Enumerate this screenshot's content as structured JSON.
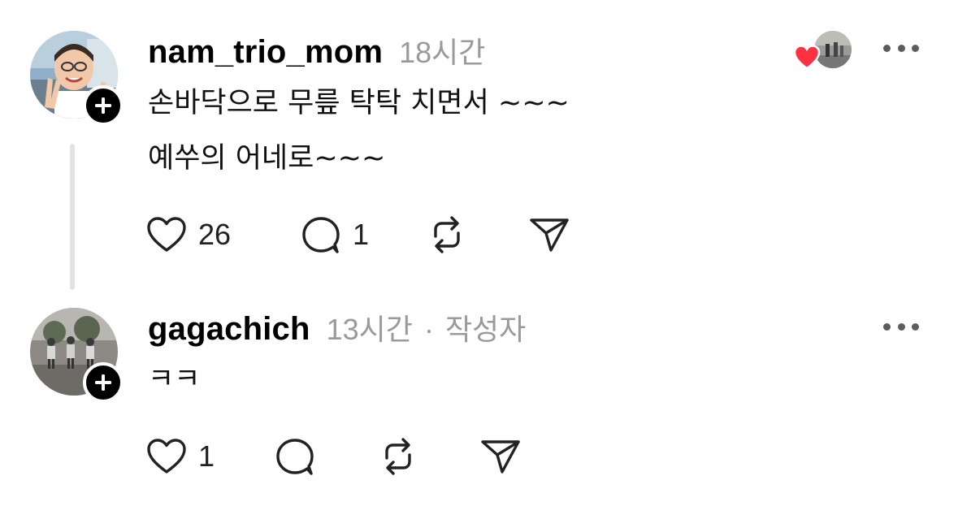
{
  "thread": [
    {
      "username": "nam_trio_mom",
      "time": "18시간",
      "lines": [
        "손바닥으로 무릎 탁탁 치면서 ~~~",
        "예쑤의 어네로~~~"
      ],
      "likes": "26",
      "replies": "1",
      "liked_by_author": true
    },
    {
      "username": "gagachich",
      "time": "13시간",
      "separator": "·",
      "role": "작성자",
      "lines": [
        "ㅋㅋ"
      ],
      "likes": "1"
    }
  ],
  "icons": {
    "like": "heart-outline-icon",
    "reply": "speech-bubble-icon",
    "repost": "repost-arrows-icon",
    "share": "paper-plane-icon",
    "follow": "plus-icon",
    "more": "ellipsis-icon",
    "liked_by": "red-heart-icon"
  },
  "colors": {
    "heart_red": "#ff3040",
    "muted_text": "#9a9a9a",
    "thread_line": "#e3e3e3"
  }
}
